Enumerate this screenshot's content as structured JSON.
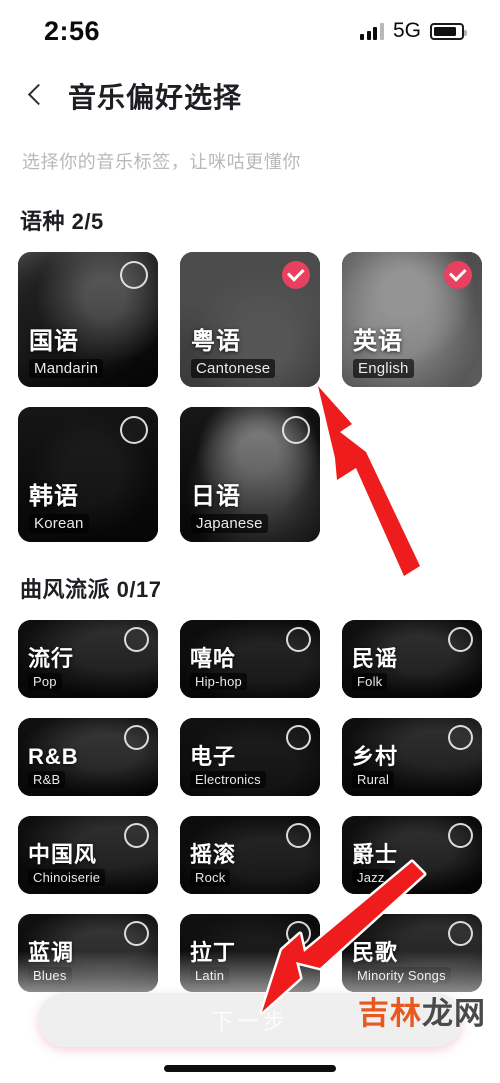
{
  "status_bar": {
    "time": "2:56",
    "network": "5G",
    "signal_icon": "signal-bars-icon",
    "battery_icon": "battery-icon"
  },
  "nav": {
    "back_icon": "back-chevron-icon",
    "title": "音乐偏好选择"
  },
  "subtitle": "选择你的音乐标签，让咪咕更懂你",
  "sections": [
    {
      "title": "语种 2/5",
      "items": [
        {
          "cn": "国语",
          "en": "Mandarin",
          "selected": false
        },
        {
          "cn": "粤语",
          "en": "Cantonese",
          "selected": true
        },
        {
          "cn": "英语",
          "en": "English",
          "selected": true
        },
        {
          "cn": "韩语",
          "en": "Korean",
          "selected": false
        },
        {
          "cn": "日语",
          "en": "Japanese",
          "selected": false
        }
      ]
    },
    {
      "title": "曲风流派 0/17",
      "items": [
        {
          "cn": "流行",
          "en": "Pop",
          "selected": false
        },
        {
          "cn": "嘻哈",
          "en": "Hip-hop",
          "selected": false
        },
        {
          "cn": "民谣",
          "en": "Folk",
          "selected": false
        },
        {
          "cn": "R&B",
          "en": "R&B",
          "selected": false
        },
        {
          "cn": "电子",
          "en": "Electronics",
          "selected": false
        },
        {
          "cn": "乡村",
          "en": "Rural",
          "selected": false
        },
        {
          "cn": "中国风",
          "en": "Chinoiserie",
          "selected": false
        },
        {
          "cn": "摇滚",
          "en": "Rock",
          "selected": false
        },
        {
          "cn": "爵士",
          "en": "Jazz",
          "selected": false
        },
        {
          "cn": "蓝调",
          "en": "Blues",
          "selected": false
        },
        {
          "cn": "拉丁",
          "en": "Latin",
          "selected": false
        },
        {
          "cn": "民歌",
          "en": "Minority Songs",
          "selected": false
        }
      ]
    }
  ],
  "next_button": {
    "label": "下一步"
  },
  "watermark": {
    "part1": "吉林",
    "part2": "龙网"
  },
  "annotations": {
    "arrow_1": "red-arrow-pointing-to-cantonese-card",
    "arrow_2": "red-arrow-pointing-to-next-button"
  },
  "colors": {
    "accent": "#e8415f",
    "button_gradient_start": "#e3738b",
    "button_gradient_end": "#d64967",
    "card_bg": "#16171b",
    "annotation_red": "#ee1c1c"
  }
}
